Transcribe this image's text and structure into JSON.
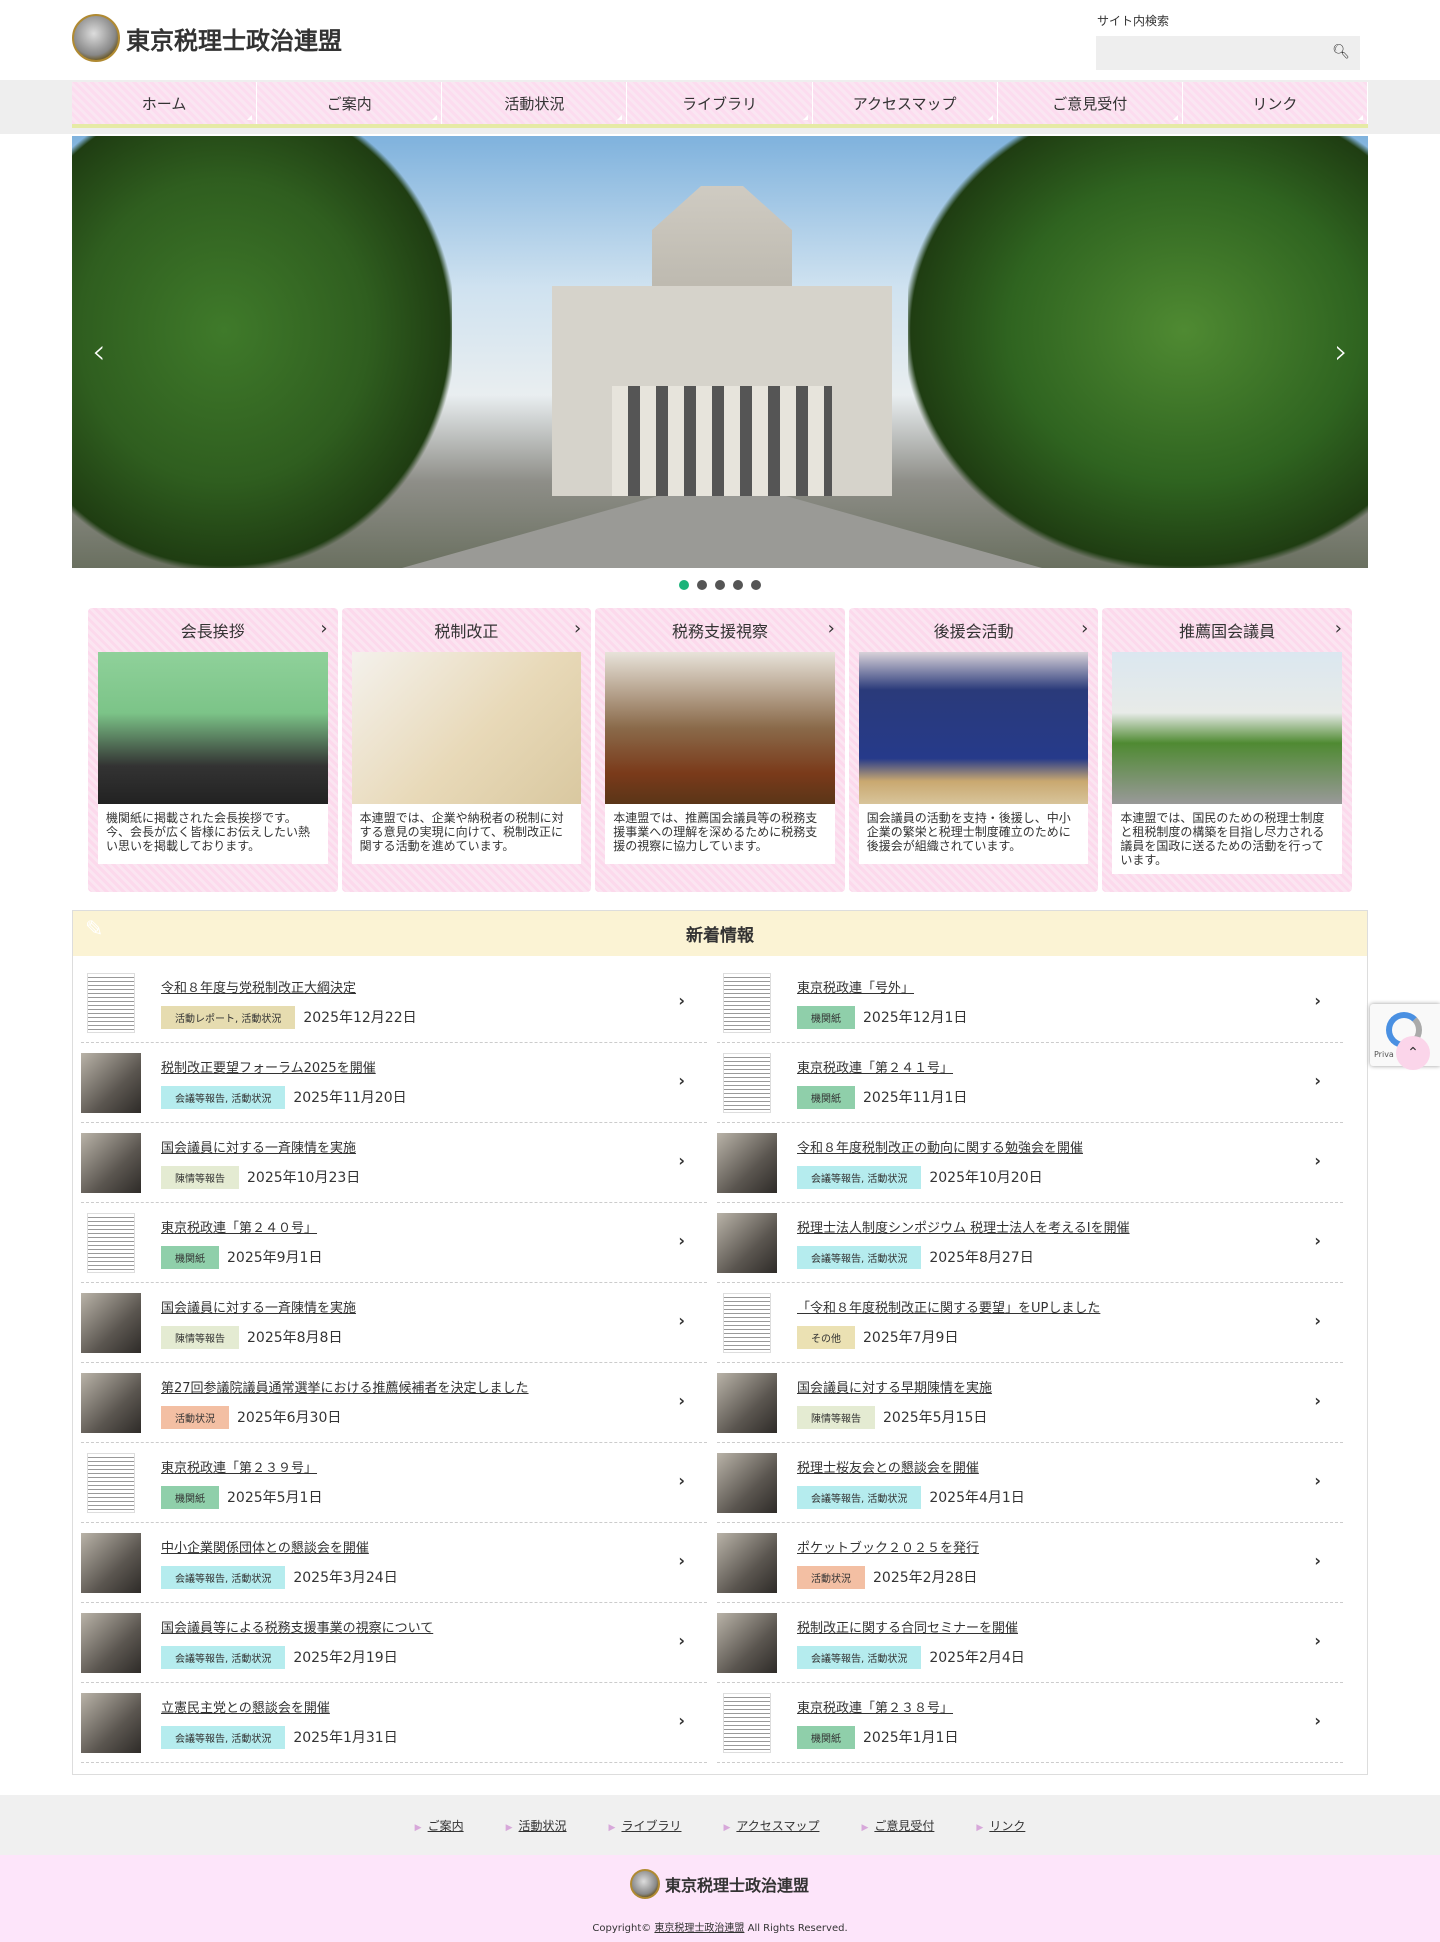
{
  "site": {
    "title": "東京税理士政治連盟"
  },
  "search": {
    "label": "サイト内検索",
    "placeholder": "",
    "icon": "search-icon"
  },
  "nav": [
    "ホーム",
    "ご案内",
    "活動状況",
    "ライブラリ",
    "アクセスマップ",
    "ご意見受付",
    "リンク"
  ],
  "slider": {
    "slide_count": 5,
    "active_index": 0,
    "prev": "‹",
    "next": "›"
  },
  "cards": [
    {
      "title": "会長挨拶",
      "text": "機関紙に掲載された会長挨拶です。今、会長が広く皆様にお伝えしたい熱い思いを掲載しております。"
    },
    {
      "title": "税制改正",
      "text": "本連盟では、企業や納税者の税制に対する意見の実現に向けて、税制改正に関する活動を進めています。"
    },
    {
      "title": "税務支援視察",
      "text": "本連盟では、推薦国会議員等の税務支援事業への理解を深めるために税務支援の視察に協力しています。"
    },
    {
      "title": "後援会活動",
      "text": "国会議員の活動を支持・後援し、中小企業の繁栄と税理士制度確立のために後援会が組織されています。"
    },
    {
      "title": "推薦国会議員",
      "text": "本連盟では、国民のための税理士制度と租税制度の構築を目指し尽力される議員を国政に送るための活動を行っています。"
    }
  ],
  "news": {
    "title": "新着情報",
    "tag_colors": {
      "活動レポート, 活動状況": "#e6dcb0",
      "会議等報告, 活動状況": "#b5ecee",
      "陳情等報告": "#e4ebd2",
      "機関紙": "#8fcfaa",
      "活動状況": "#f3bfa3",
      "その他": "#ebe1b3"
    },
    "items": [
      {
        "title": "令和８年度与党税制改正大綱決定",
        "tag": "活動レポート, 活動状況",
        "date": "2025年12月22日",
        "doc": true
      },
      {
        "title": "東京税政連「号外」",
        "tag": "機関紙",
        "date": "2025年12月1日",
        "doc": true
      },
      {
        "title": "税制改正要望フォーラム2025を開催",
        "tag": "会議等報告, 活動状況",
        "date": "2025年11月20日"
      },
      {
        "title": "東京税政連「第２４１号」",
        "tag": "機関紙",
        "date": "2025年11月1日",
        "doc": true
      },
      {
        "title": "国会議員に対する一斉陳情を実施",
        "tag": "陳情等報告",
        "date": "2025年10月23日"
      },
      {
        "title": "令和８年度税制改正の動向に関する勉強会を開催",
        "tag": "会議等報告, 活動状況",
        "date": "2025年10月20日"
      },
      {
        "title": "東京税政連「第２４０号」",
        "tag": "機関紙",
        "date": "2025年9月1日",
        "doc": true
      },
      {
        "title": "税理士法人制度シンポジウム 税理士法人を考えるⅠを開催",
        "tag": "会議等報告, 活動状況",
        "date": "2025年8月27日"
      },
      {
        "title": "国会議員に対する一斉陳情を実施",
        "tag": "陳情等報告",
        "date": "2025年8月8日"
      },
      {
        "title": "「令和８年度税制改正に関する要望」をUPしました",
        "tag": "その他",
        "date": "2025年7月9日",
        "doc": true
      },
      {
        "title": "第27回参議院議員通常選挙における推薦候補者を決定しました",
        "tag": "活動状況",
        "date": "2025年6月30日"
      },
      {
        "title": "国会議員に対する早期陳情を実施",
        "tag": "陳情等報告",
        "date": "2025年5月15日"
      },
      {
        "title": "東京税政連「第２３９号」",
        "tag": "機関紙",
        "date": "2025年5月1日",
        "doc": true
      },
      {
        "title": "税理士桜友会との懇談会を開催",
        "tag": "会議等報告, 活動状況",
        "date": "2025年4月1日"
      },
      {
        "title": "中小企業関係団体との懇談会を開催",
        "tag": "会議等報告, 活動状況",
        "date": "2025年3月24日"
      },
      {
        "title": "ポケットブック２０２５を発行",
        "tag": "活動状況",
        "date": "2025年2月28日"
      },
      {
        "title": "国会議員等による税務支援事業の視察について",
        "tag": "会議等報告, 活動状況",
        "date": "2025年2月19日"
      },
      {
        "title": "税制改正に関する合同セミナーを開催",
        "tag": "会議等報告, 活動状況",
        "date": "2025年2月4日"
      },
      {
        "title": "立憲民主党との懇談会を開催",
        "tag": "会議等報告, 活動状況",
        "date": "2025年1月31日"
      },
      {
        "title": "東京税政連「第２３８号」",
        "tag": "機関紙",
        "date": "2025年1月1日",
        "doc": true
      }
    ]
  },
  "footer": {
    "links": [
      "ご案内",
      "活動状況",
      "ライブラリ",
      "アクセスマップ",
      "ご意見受付",
      "リンク"
    ],
    "copyright_prefix": "Copyright© ",
    "copyright_link": "東京税理士政治連盟",
    "copyright_suffix": " All Rights Reserved."
  },
  "recaptcha": {
    "label": "Priva"
  }
}
